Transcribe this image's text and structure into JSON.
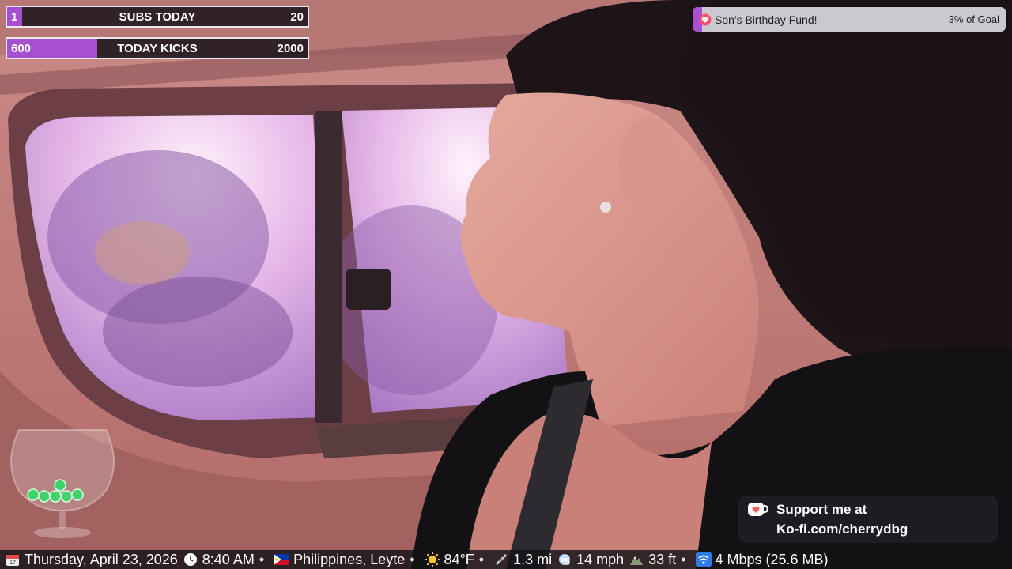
{
  "goal_bars": {
    "subs": {
      "current": "1",
      "label": "SUBS TODAY",
      "target": "20",
      "progress": 0.05
    },
    "kicks": {
      "current": "600",
      "label": "TODAY KICKS",
      "target": "2000",
      "progress": 0.3
    }
  },
  "tip_goal": {
    "title": "Son's Birthday Fund!",
    "percent_label": "3% of Goal",
    "progress": 0.03,
    "icon": "heart-icon"
  },
  "kofi": {
    "line1": "Support me at",
    "line2": "Ko-fi.com/cherrydbg",
    "icon": "kofi-cup-icon"
  },
  "ticker": {
    "date": "Thursday, April 23, 2026",
    "time": "8:40 AM",
    "location": "Philippines,  Leyte",
    "temperature": "84°F",
    "distance": "1.3 mi",
    "wind": "14 mph",
    "altitude": "33 ft",
    "network": "4 Mbps (25.6 MB)",
    "separator": "•"
  },
  "colors": {
    "accent_purple": "#a64fd1",
    "bar_bg": "#141018",
    "tip_bg": "#c9c9cf"
  }
}
